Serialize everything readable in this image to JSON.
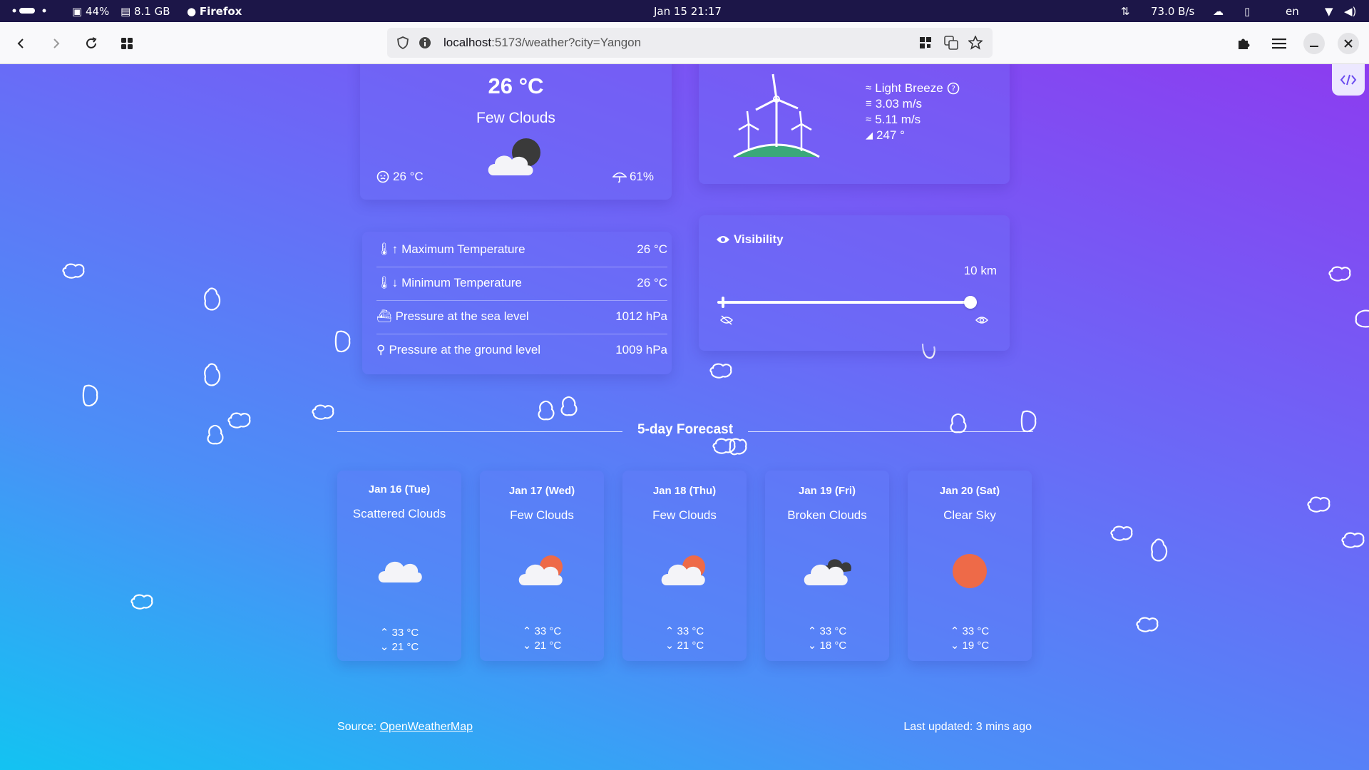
{
  "system_bar": {
    "battery": "44%",
    "memory": "8.1 GB",
    "app_name": "Firefox",
    "datetime": "Jan 15  21:17",
    "network_speed": "73.0 B/s",
    "language": "en"
  },
  "browser": {
    "url_host": "localhost",
    "url_rest": ":5173/weather?city=Yangon"
  },
  "current": {
    "temperature": "26 °C",
    "condition": "Few Clouds",
    "feels_like": "26 °C",
    "humidity": "61%"
  },
  "wind": {
    "description": "Light Breeze",
    "speed": "3.03 m/s",
    "gust": "5.11 m/s",
    "direction": "247 °"
  },
  "visibility": {
    "title": "Visibility",
    "value": "10 km",
    "level": 1.0
  },
  "details": [
    {
      "label": "Maximum Temperature",
      "value": "26 °C",
      "icon": "thermometer-up-icon"
    },
    {
      "label": "Minimum Temperature",
      "value": "26 °C",
      "icon": "thermometer-down-icon"
    },
    {
      "label": "Pressure at the sea level",
      "value": "1012 hPa",
      "icon": "ship-icon"
    },
    {
      "label": "Pressure at the ground level",
      "value": "1009 hPa",
      "icon": "ground-pressure-icon"
    }
  ],
  "forecast": {
    "title": "5-day Forecast",
    "days": [
      {
        "date": "Jan 16  (Tue)",
        "condition": "Scattered Clouds",
        "high": "33 °C",
        "low": "21 °C",
        "icon": "scattered-clouds-icon"
      },
      {
        "date": "Jan 17  (Wed)",
        "condition": "Few Clouds",
        "high": "33 °C",
        "low": "21 °C",
        "icon": "few-clouds-icon"
      },
      {
        "date": "Jan 18  (Thu)",
        "condition": "Few Clouds",
        "high": "33 °C",
        "low": "21 °C",
        "icon": "few-clouds-icon"
      },
      {
        "date": "Jan 19  (Fri)",
        "condition": "Broken Clouds",
        "high": "33 °C",
        "low": "18 °C",
        "icon": "broken-clouds-icon"
      },
      {
        "date": "Jan 20  (Sat)",
        "condition": "Clear Sky",
        "high": "33 °C",
        "low": "19 °C",
        "icon": "clear-sky-icon"
      }
    ]
  },
  "footer": {
    "source_label": "Source:",
    "source_link": "OpenWeatherMap",
    "last_updated": "Last updated: 3 mins ago"
  },
  "colors": {
    "sun": "#ee6a48",
    "ground": "#3aa87a"
  }
}
